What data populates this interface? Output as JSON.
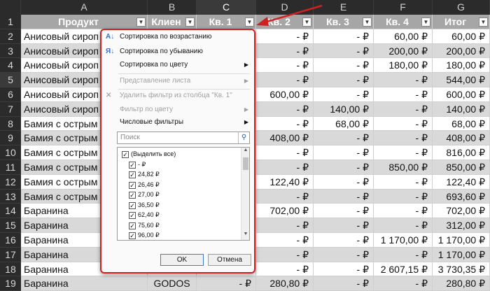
{
  "columns": {
    "a": "A",
    "b": "B",
    "c": "C",
    "d": "D",
    "e": "E",
    "f": "F",
    "g": "G"
  },
  "headers": {
    "a": "Продукт",
    "b": "Клиен",
    "c": "Кв. 1",
    "d": "Кв. 2",
    "e": "Кв. 3",
    "f": "Кв. 4",
    "g": "Итог"
  },
  "rows": [
    {
      "n": "1"
    },
    {
      "n": "2",
      "a": "Анисовый сироп",
      "d": "-  ₽",
      "e": "-  ₽",
      "f": "60,00 ₽",
      "g": "60,00 ₽"
    },
    {
      "n": "3",
      "a": "Анисовый сироп",
      "d": "-  ₽",
      "e": "-  ₽",
      "f": "200,00 ₽",
      "g": "200,00 ₽"
    },
    {
      "n": "4",
      "a": "Анисовый сироп",
      "d": "-  ₽",
      "e": "-  ₽",
      "f": "180,00 ₽",
      "g": "180,00 ₽"
    },
    {
      "n": "5",
      "a": "Анисовый сироп",
      "d": "-  ₽",
      "e": "-  ₽",
      "f": "-  ₽",
      "g": "544,00 ₽"
    },
    {
      "n": "6",
      "a": "Анисовый сироп",
      "d": "600,00 ₽",
      "e": "-  ₽",
      "f": "-  ₽",
      "g": "600,00 ₽"
    },
    {
      "n": "7",
      "a": "Анисовый сироп",
      "d": "-  ₽",
      "e": "140,00 ₽",
      "f": "-  ₽",
      "g": "140,00 ₽"
    },
    {
      "n": "8",
      "a": "Бамия с острым",
      "d": "-  ₽",
      "e": "68,00 ₽",
      "f": "-  ₽",
      "g": "68,00 ₽"
    },
    {
      "n": "9",
      "a": "Бамия с острым",
      "d": "408,00 ₽",
      "e": "-  ₽",
      "f": "-  ₽",
      "g": "408,00 ₽"
    },
    {
      "n": "10",
      "a": "Бамия с острым",
      "d": "-  ₽",
      "e": "-  ₽",
      "f": "-  ₽",
      "g": "816,00 ₽"
    },
    {
      "n": "11",
      "a": "Бамия с острым",
      "d": "-  ₽",
      "e": "-  ₽",
      "f": "850,00 ₽",
      "g": "850,00 ₽"
    },
    {
      "n": "12",
      "a": "Бамия с острым",
      "d": "122,40 ₽",
      "e": "-  ₽",
      "f": "-  ₽",
      "g": "122,40 ₽"
    },
    {
      "n": "13",
      "a": "Бамия с острым",
      "d": "-  ₽",
      "e": "-  ₽",
      "f": "-  ₽",
      "g": "693,60 ₽"
    },
    {
      "n": "14",
      "a": "Баранина",
      "d": "702,00 ₽",
      "e": "-  ₽",
      "f": "-  ₽",
      "g": "702,00 ₽"
    },
    {
      "n": "15",
      "a": "Баранина",
      "d": "-  ₽",
      "e": "-  ₽",
      "f": "-  ₽",
      "g": "312,00 ₽"
    },
    {
      "n": "16",
      "a": "Баранина",
      "d": "-  ₽",
      "e": "-  ₽",
      "f": "1 170,00 ₽",
      "g": "1 170,00 ₽"
    },
    {
      "n": "17",
      "a": "Баранина",
      "d": "-  ₽",
      "e": "-  ₽",
      "f": "-  ₽",
      "g": "1 170,00 ₽"
    },
    {
      "n": "18",
      "a": "Баранина",
      "d": "-  ₽",
      "e": "-  ₽",
      "f": "2 607,15 ₽",
      "g": "3 730,35 ₽"
    },
    {
      "n": "19",
      "a": "Баранина",
      "b": "GODOS",
      "c": "-  ₽",
      "d": "280,80 ₽",
      "e": "-  ₽",
      "f": "-  ₽",
      "g": "280,80 ₽"
    }
  ],
  "menu": {
    "sort_asc": "Сортировка по возрастанию",
    "sort_desc": "Сортировка по убыванию",
    "sort_color": "Сортировка по цвету",
    "sheet_view": "Представление листа",
    "clear_filter": "Удалить фильтр из столбца \"Кв. 1\"",
    "filter_color": "Фильтр по цвету",
    "number_filters": "Числовые фильтры",
    "search_placeholder": "Поиск",
    "items": [
      "(Выделить все)",
      "-  ₽",
      "24,82 ₽",
      "26,46 ₽",
      "27,00 ₽",
      "36,50 ₽",
      "62,40 ₽",
      "75,60 ₽",
      "96,00 ₽"
    ],
    "ok": "OK",
    "cancel": "Отмена"
  },
  "colors": {
    "header_fill": "#a6a6a6",
    "row_even": "#ffffff",
    "row_odd": "#d9d9d9",
    "highlight": "#d12020",
    "accent": "#3a7bd5"
  }
}
